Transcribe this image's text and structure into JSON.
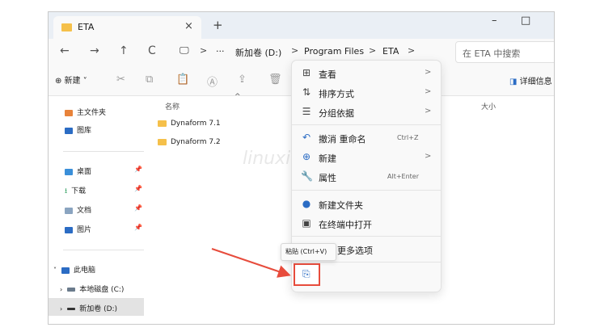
{
  "window": {
    "tab_title": "ETA",
    "tab_close": "×",
    "new_tab": "+",
    "minimize": "–",
    "maximize": "□"
  },
  "nav": {
    "back": "←",
    "forward": "→",
    "up": "↑",
    "refresh": "C",
    "ellipsis": "···",
    "breadcrumb": [
      "新加卷 (D:)",
      "Program Files",
      "ETA"
    ],
    "separator": ">",
    "search_placeholder": "在 ETA 中搜索"
  },
  "toolbar": {
    "new_label": "⊕ 新建 ˅",
    "details_label": "详细信息"
  },
  "sidebar": {
    "home": "主文件夹",
    "gallery": "图库",
    "desktop": "桌面",
    "downloads": "下载",
    "documents": "文档",
    "pictures": "图片",
    "this_pc": "此电脑",
    "local_disk": "本地磁盘 (C:)",
    "new_volume": "新加卷 (D:)",
    "pin": "📌"
  },
  "columns": {
    "name": "名称",
    "size": "大小",
    "sort_arrow": "^"
  },
  "files": [
    "Dynaform 7.1",
    "Dynaform 7.2"
  ],
  "context_menu": {
    "view": "查看",
    "sort": "排序方式",
    "group": "分组依据",
    "undo": "撤消 重命名",
    "undo_shortcut": "Ctrl+Z",
    "new": "新建",
    "properties": "属性",
    "properties_shortcut": "Alt+Enter",
    "new_folder": "新建文件夹",
    "terminal": "在终端中打开",
    "more_options": "更多选项",
    "arrow": ">"
  },
  "tooltip": "粘贴 (Ctrl+V)",
  "watermark": "linuxidc.k",
  "icons": [
    "folder-icon",
    "chevron-right-icon",
    "cut-icon",
    "copy-icon",
    "paste-icon",
    "rename-icon",
    "share-icon",
    "delete-icon",
    "view-icon",
    "sort-icon",
    "group-icon",
    "undo-icon",
    "new-icon",
    "properties-icon",
    "new-folder-icon",
    "terminal-icon"
  ],
  "colors": {
    "accent_red": "#e74c3c",
    "folder_yellow": "#f5c04a",
    "icon_blue": "#2b6cc4"
  }
}
